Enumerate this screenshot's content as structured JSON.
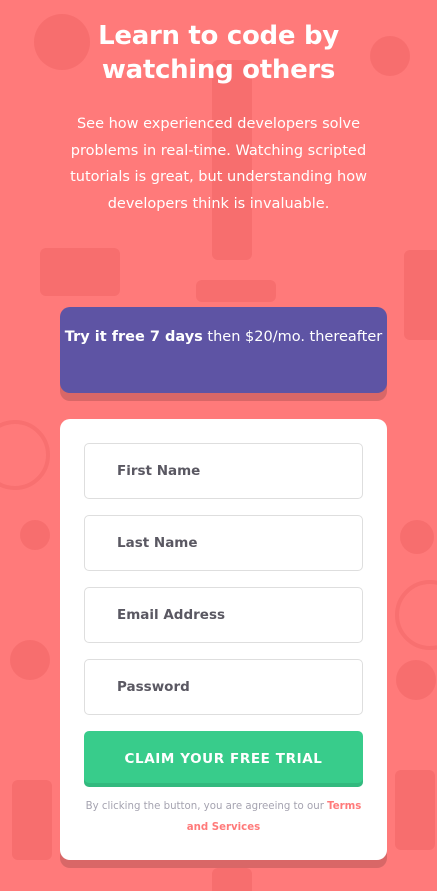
{
  "colors": {
    "background": "#ff7a7a",
    "offer_background": "#5e54a4",
    "cta_background": "#38cc8b",
    "terms_link": "#ff7a7a"
  },
  "header": {
    "title": "Learn to code by watching others",
    "intro": "See how experienced developers solve problems in real-time. Watching scripted tutorials is great, but understanding how developers think is invaluable."
  },
  "offer": {
    "highlight": "Try it free 7 days",
    "rest": " then $20/mo. thereafter"
  },
  "form": {
    "first_name_placeholder": "First Name",
    "last_name_placeholder": "Last Name",
    "email_placeholder": "Email Address",
    "password_placeholder": "Password",
    "submit_label": "CLAIM YOUR FREE TRIAL",
    "terms_prefix": "By clicking the button, you are agreeing to our ",
    "terms_link": "Terms and Services"
  }
}
